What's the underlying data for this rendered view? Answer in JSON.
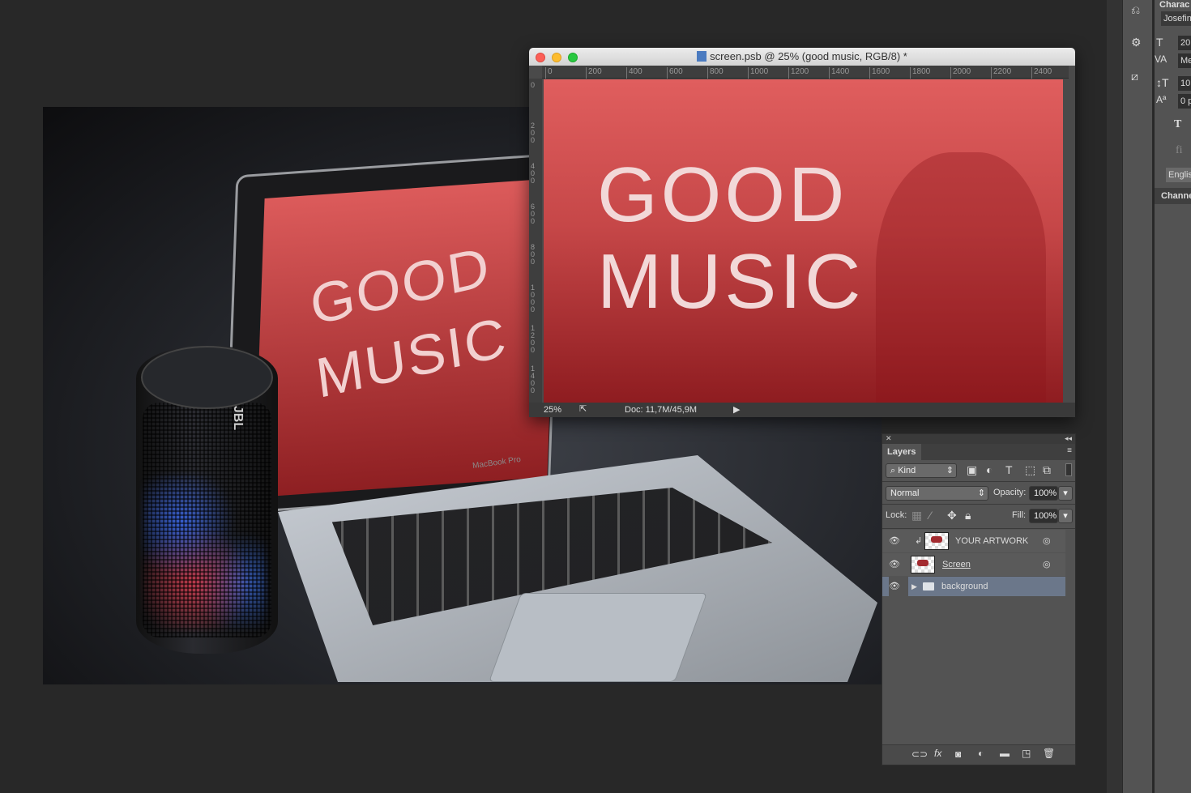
{
  "photo": {
    "laptop_screen_line1": "GOOD",
    "laptop_screen_line2": "MUSIC",
    "speaker_brand": "JBL",
    "laptop_brand": "MacBook Pro"
  },
  "document": {
    "title": "screen.psb @ 25% (good music, RGB/8) *",
    "ruler_h": [
      "0",
      "200",
      "400",
      "600",
      "800",
      "1000",
      "1200",
      "1400",
      "1600",
      "1800",
      "2000",
      "2200",
      "2400"
    ],
    "ruler_v": [
      "0",
      "200",
      "400",
      "600",
      "800",
      "1000",
      "1200",
      "1400"
    ],
    "canvas_line1": "GOOD",
    "canvas_line2": "MUSIC",
    "zoom": "25%",
    "doc_info": "Doc: 11,7M/45,9M",
    "canvas_colors": [
      "#e05e5e",
      "#8e1c20"
    ]
  },
  "layers": {
    "tab": "Layers",
    "filter": "Kind",
    "blend_mode": "Normal",
    "opacity_label": "Opacity:",
    "opacity": "100%",
    "lock_label": "Lock:",
    "fill_label": "Fill:",
    "fill": "100%",
    "items": [
      {
        "name": "YOUR ARTWORK",
        "visible": true
      },
      {
        "name": "Screen",
        "visible": true
      },
      {
        "name": "background",
        "visible": true,
        "type": "group",
        "selected": true
      }
    ],
    "selected_color": "#6b778a"
  },
  "character": {
    "header": "Charac",
    "font": "Josefin",
    "size": "20",
    "kerning": "Me",
    "leading": "10",
    "baseline": "0 p",
    "language": "Englis",
    "channels_tab": "Channe"
  }
}
